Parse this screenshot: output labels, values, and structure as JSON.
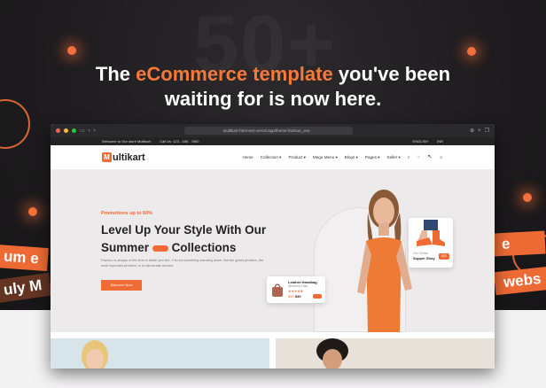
{
  "promo": {
    "headline_line1_prefix": "The ",
    "headline_accent": "eCommerce template",
    "headline_line1_suffix": " you've been",
    "headline_line2": "waiting for is now here.",
    "background_number": "50+",
    "ribbon_left_1": "um e",
    "ribbon_left_2": "uly M",
    "ribbon_right_1": "e",
    "ribbon_right_2": "webs",
    "accent_color": "#f57a3a"
  },
  "browser": {
    "url": "multikart-html-vert.vercel.app/theme-fashion_one",
    "icons": [
      "sidebar-icon",
      "back-icon",
      "forward-icon",
      "shield-icon",
      "reload-icon",
      "download-icon",
      "plus-icon",
      "tabs-icon"
    ]
  },
  "site": {
    "topbar_welcome": "Welcome to Our store Multikart",
    "topbar_phone": "Call Us: 123 - 456 - 7890",
    "language": "ENGLISH",
    "currency": "INR",
    "logo_letter": "M",
    "logo_rest": "ultikart",
    "menu": [
      "Home",
      "Collection",
      "Product",
      "Mega Menu",
      "Blogs",
      "Pages",
      "Seller"
    ],
    "hero": {
      "promo": "Promotions up to 60%",
      "title_line1": "Level Up Your Style With Our",
      "title_line2_a": "Summer",
      "title_line2_b": "Collections",
      "pill_text": "",
      "description": "Fashion is always of the time in which you live. It is not something standing alone. But the grand problem, the most important problem, is to rejuvenate women.",
      "cta": "Discover Now"
    },
    "card_bag": {
      "title": "Leather Handbag",
      "subtitle": "Women's Fash",
      "rating": "★★★★★",
      "price_old": "$46",
      "price_new": "$39",
      "badge": ""
    },
    "card_shoe": {
      "subtitle": "Our Choice",
      "title": "Supper Shoy",
      "badge": "$32"
    }
  }
}
